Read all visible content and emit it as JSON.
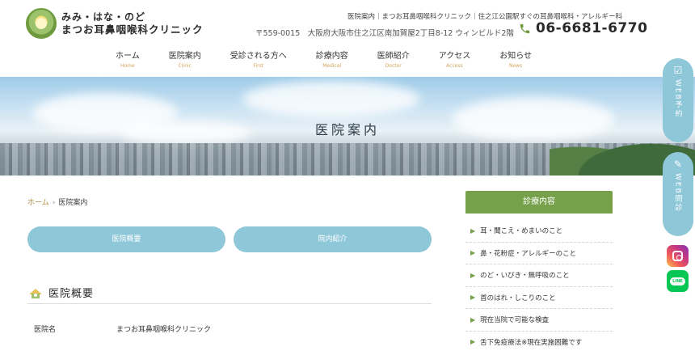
{
  "header": {
    "logo_sub": "みみ・はな・のど",
    "logo_main": "まつお耳鼻咽喉科クリニック",
    "tagline": "医院案内｜まつお耳鼻咽喉科クリニック｜住之江公園駅すぐの耳鼻咽喉科・アレルギー科",
    "address": "〒559-0015　大阪府大阪市住之江区南加賀屋2丁目8-12 ウィンビルド2階",
    "phone": "06-6681-6770",
    "phone_icon": "phone-icon"
  },
  "nav": [
    {
      "jp": "ホーム",
      "en": "Home"
    },
    {
      "jp": "医院案内",
      "en": "Clinic"
    },
    {
      "jp": "受診される方へ",
      "en": "First"
    },
    {
      "jp": "診療内容",
      "en": "Medical"
    },
    {
      "jp": "医師紹介",
      "en": "Doctor"
    },
    {
      "jp": "アクセス",
      "en": "Access"
    },
    {
      "jp": "お知らせ",
      "en": "News"
    }
  ],
  "hero": {
    "title": "医院案内"
  },
  "breadcrumb": {
    "home": "ホーム",
    "sep": "›",
    "current": "医院案内"
  },
  "tabs": [
    {
      "label": "医院概要"
    },
    {
      "label": "院内紹介"
    }
  ],
  "section": {
    "title": "医院概要",
    "icon": "clinic-bird-icon"
  },
  "info": [
    {
      "label": "医院名",
      "value": "まつお耳鼻咽喉科クリニック"
    }
  ],
  "sidebar": {
    "heading": "診療内容",
    "items": [
      "耳・聞こえ・めまいのこと",
      "鼻・花粉症・アレルギーのこと",
      "のど・いびき・無呼吸のこと",
      "首のはれ・しこりのこと",
      "現在当院で可能な検査",
      "舌下免疫療法※現在実施困難です"
    ]
  },
  "floating": {
    "web_reserve": "WEB予約",
    "web_inquiry": "WEB問診",
    "instagram": "instagram-icon",
    "line": "LINE"
  },
  "colors": {
    "accent_green": "#76a04a",
    "accent_blue": "#8ec7d8",
    "nav_en": "#d4a55a"
  }
}
